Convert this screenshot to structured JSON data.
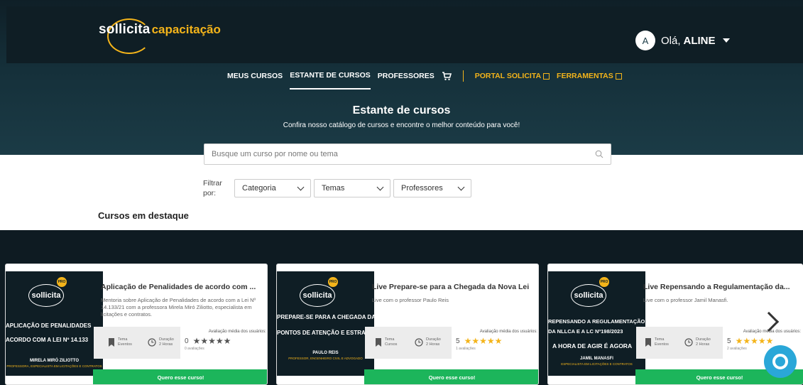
{
  "brand": {
    "name": "sollicita",
    "suffix": "capacitação",
    "accent": "#f4b41a"
  },
  "user": {
    "initial": "A",
    "greeting": "Olá,",
    "name": "ALINE"
  },
  "nav": {
    "items": [
      "MEUS CURSOS",
      "ESTANTE DE CURSOS",
      "PROFESSORES"
    ],
    "active": "ESTANTE DE CURSOS",
    "cart_icon": "cart-icon",
    "external": [
      "PORTAL SOLICITA",
      "FERRAMENTAS"
    ]
  },
  "hero": {
    "title": "Estante de cursos",
    "subtitle": "Confira nosso catálogo de cursos e encontre o melhor conteúdo para você!"
  },
  "search": {
    "placeholder": "Busque um curso por nome ou tema",
    "value": ""
  },
  "filters": {
    "label_line1": "Filtrar",
    "label_line2": "por:",
    "options": [
      "Categoria",
      "Temas",
      "Professores"
    ]
  },
  "section": {
    "title": "Cursos em destaque"
  },
  "cards": [
    {
      "title": "Aplicação de Penalidades de acordo com ...",
      "description": "Mentoria sobre Aplicação de Penalidades de acordo com a Lei Nº 14.133/21 com a professora Mirela Miró Ziliotto, especialista em licitações e contratos.",
      "thumb_line1": "APLICAÇÃO DE PENALIDADES",
      "thumb_line2": "ACORDO COM A LEI Nº 14.133",
      "thumb_name": "MIRELA MIRÓ ZILIOTTO",
      "thumb_role": "PROFESSORA, ESPECIALISTA EM LICITAÇÕES E CONTRATOS",
      "theme_label": "Tema",
      "theme_value": "Eventos",
      "duration_label": "Duração",
      "duration_value": "2 Horas",
      "rating_label": "Avaliação média dos usuários:",
      "rating": "0",
      "rating_count": "0 avaliações",
      "button": "Quero esse curso!"
    },
    {
      "title": "Live Prepare-se para a Chegada da Nova Lei",
      "description": "Live com o professor Paulo Reis",
      "thumb_line1": "PREPARE-SE PARA A CHEGADA DA",
      "thumb_line2": "PONTOS DE ATENÇÃO E ESTRATÉGIAS",
      "thumb_name": "PAULO REIS",
      "thumb_role": "PROFESSOR, ENGENHEIRO CIVIL E ADVOGADO",
      "theme_label": "Tema",
      "theme_value": "Cursos",
      "duration_label": "Duração",
      "duration_value": "2 Horas",
      "rating_label": "Avaliação média dos usuários:",
      "rating": "5",
      "rating_count": "1 avaliações",
      "button": "Quero esse curso!"
    },
    {
      "title": "Live Repensando a Regulamentação da...",
      "description": "Live com o professor Jamil Manasfi.",
      "thumb_line1": "REPENSANDO A REGULAMENTAÇÃO",
      "thumb_line2": "DA NLLCA E A LC Nº198/2023",
      "thumb_line3": "A HORA DE AGIR É AGORA",
      "thumb_name": "JAMIL MANASFI",
      "thumb_role": "ESPECIALISTA EM LICITAÇÕES E CONTRATOS",
      "theme_label": "Tema",
      "theme_value": "Eventos",
      "duration_label": "Duração",
      "duration_value": "2 Horas",
      "rating_label": "Avaliação média dos usuários:",
      "rating": "5",
      "rating_count": "2 avaliações",
      "button": "Quero esse curso!"
    }
  ],
  "colors": {
    "header_bg": "#0f1e25",
    "button_green": "#1cb55b",
    "star_gold": "#f4b41a",
    "star_gray": "#555555",
    "chat_blue": "#2aa7d8"
  }
}
